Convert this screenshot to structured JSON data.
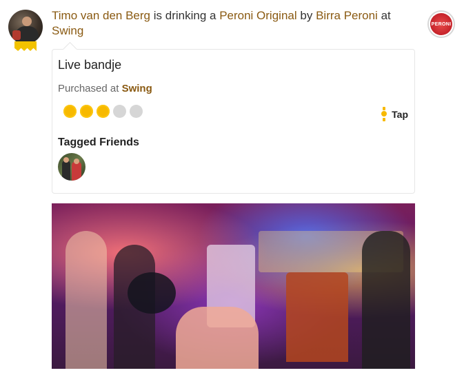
{
  "checkin": {
    "user_name": "Timo van den Berg",
    "verb": "is drinking a",
    "beer_name": "Peroni Original",
    "by_word": "by",
    "brewery_name": "Birra Peroni",
    "at_word": "at",
    "venue_name": "Swing",
    "comment": "Live bandje",
    "purchased_label": "Purchased at",
    "purchased_venue": "Swing",
    "rating": {
      "value": 3,
      "max": 5
    },
    "serving_style": "Tap",
    "tagged_friends_title": "Tagged Friends"
  },
  "brewery_logo_text": "PERONI",
  "colors": {
    "link": "#8a5a12",
    "rating_on": "#f7b900",
    "rating_off": "#d6d6d6",
    "badge": "#f2c200"
  },
  "icons": {
    "serving": "tap-icon",
    "badge": "badge-ribbon-icon"
  }
}
